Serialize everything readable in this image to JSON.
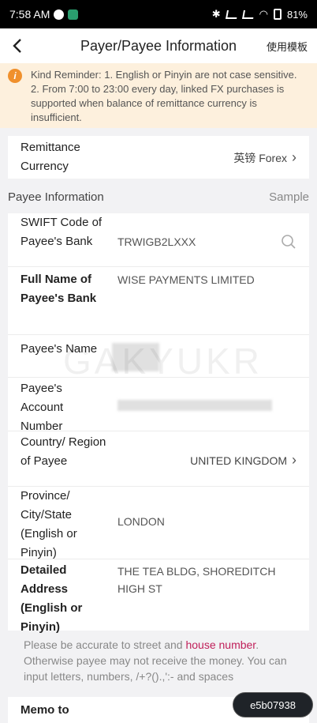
{
  "status_bar": {
    "time": "7:58 AM",
    "battery": "81%"
  },
  "header": {
    "title": "Payer/Payee Information",
    "template_link": "使用模板"
  },
  "reminder": {
    "text": "Kind Reminder: 1. English or Pinyin are not case sensitive. 2. From 7:00 to 23:00 every day, linked FX purchases is supported when balance of remittance currency is insufficient."
  },
  "remittance": {
    "label": "Remittance Currency",
    "value": "英镑 Forex"
  },
  "payee_section": {
    "title": "Payee Information",
    "sample_link": "Sample"
  },
  "fields": {
    "swift": {
      "label": "SWIFT Code of Payee's Bank",
      "value": "TRWIGB2LXXX"
    },
    "bank_name": {
      "label": "Full Name of Payee's Bank",
      "value": "WISE PAYMENTS LIMITED"
    },
    "payee_name": {
      "label": "Payee's Name"
    },
    "account": {
      "label": "Payee's Account Number"
    },
    "country": {
      "label": "Country/ Region of Payee",
      "value": "UNITED KINGDOM"
    },
    "province": {
      "label": "Province/ City/State (English or Pinyin)",
      "value": "LONDON"
    },
    "address": {
      "label": "Detailed Address (English or Pinyin)",
      "value": "THE TEA BLDG, SHOREDITCH HIGH ST"
    }
  },
  "hint": {
    "part1": "Please be accurate to street and ",
    "highlight": "house number",
    "part2": ". Otherwise payee may not receive the money. You can input letters, numbers, /+?().,':- and spaces"
  },
  "memo": {
    "label": "Memo to"
  },
  "watermark": "GAKYUKR",
  "badge": "e5b07938",
  "colors": {
    "accent_orange": "#f0902c",
    "highlight": "#c0205a",
    "reminder_bg": "#fdf0dd"
  }
}
